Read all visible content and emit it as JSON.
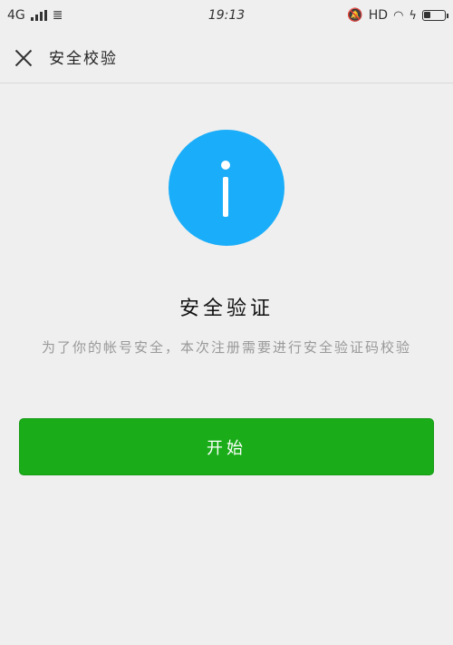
{
  "status_bar": {
    "network": "4G",
    "time": "19:13",
    "hd": "HD",
    "battery_level": 0.35
  },
  "nav": {
    "title": "安全校验"
  },
  "content": {
    "title": "安全验证",
    "description": "为了你的帐号安全，本次注册需要进行安全验证码校验",
    "start_button": "开始"
  },
  "colors": {
    "accent_blue": "#1aadf9",
    "button_green": "#1aad19",
    "background": "#efefef"
  }
}
